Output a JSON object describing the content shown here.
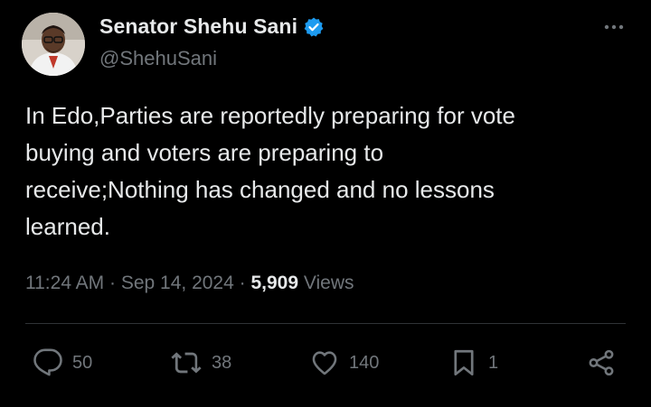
{
  "author": {
    "display_name": "Senator Shehu Sani",
    "handle": "@ShehuSani",
    "verified": true
  },
  "tweet": {
    "text": "In Edo,Parties are reportedly preparing for vote\nbuying and voters are preparing to\nreceive;Nothing has changed and no lessons\nlearned.",
    "time": "11:24 AM",
    "date": "Sep 14, 2024",
    "separator": " · ",
    "views_count": "5,909",
    "views_label": "Views"
  },
  "actions": {
    "replies": "50",
    "reposts": "38",
    "likes": "140",
    "bookmarks": "1"
  },
  "colors": {
    "background": "#000000",
    "text_primary": "#e7e9ea",
    "text_secondary": "#71767b",
    "verified_badge": "#1d9bf0",
    "divider": "#2f3336"
  },
  "icons": {
    "more": "more-dots-icon",
    "verified": "verified-badge-icon",
    "reply": "reply-icon",
    "repost": "repost-icon",
    "like": "heart-icon",
    "bookmark": "bookmark-icon",
    "share": "share-icon"
  }
}
